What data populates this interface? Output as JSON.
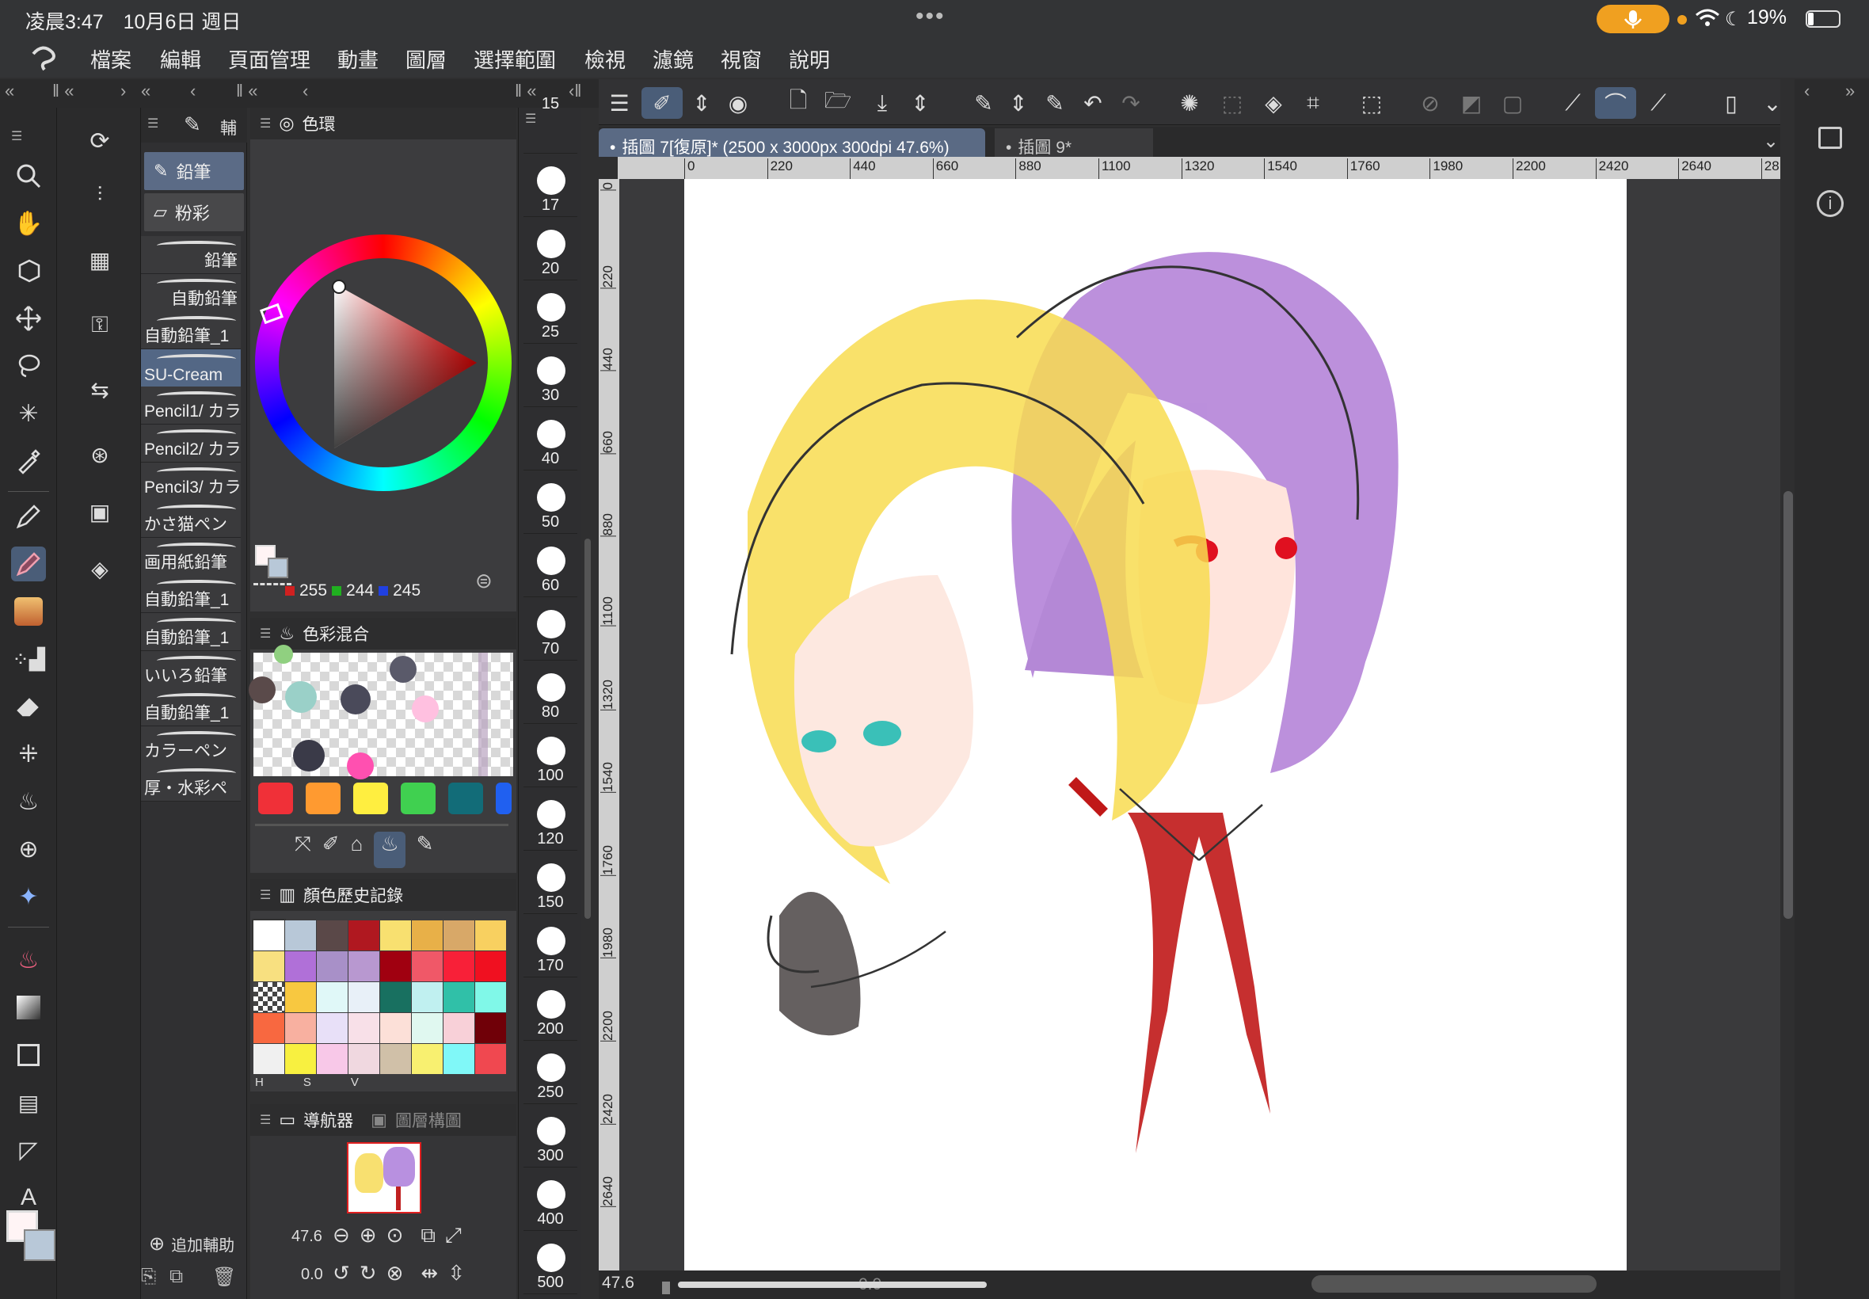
{
  "status": {
    "time": "凌晨3:47　10月6日 週日",
    "dots": "•••",
    "battery": "19%"
  },
  "menu": [
    "檔案",
    "編輯",
    "頁面管理",
    "動畫",
    "圖層",
    "選擇範圍",
    "檢視",
    "濾鏡",
    "視窗",
    "說明"
  ],
  "brush_panel": {
    "header": "輔",
    "tabs": [
      {
        "label": "鉛筆",
        "selected": true
      },
      {
        "label": "粉彩",
        "selected": false
      }
    ],
    "items": [
      {
        "label": "鉛筆",
        "selected": false
      },
      {
        "label": "自動鉛筆",
        "selected": false
      },
      {
        "label": "自動鉛筆_1",
        "selected": false
      },
      {
        "label": "SU-Cream",
        "selected": true
      },
      {
        "label": "Pencil1/ カラ",
        "selected": false
      },
      {
        "label": "Pencil2/ カラ",
        "selected": false
      },
      {
        "label": "Pencil3/ カラ",
        "selected": false
      },
      {
        "label": "かさ猫ペン",
        "selected": false
      },
      {
        "label": "画用紙鉛筆",
        "selected": false
      },
      {
        "label": "自動鉛筆_1",
        "selected": false
      },
      {
        "label": "自動鉛筆_1",
        "selected": false
      },
      {
        "label": "いいろ鉛筆",
        "selected": false
      },
      {
        "label": "自動鉛筆_1",
        "selected": false
      },
      {
        "label": "カラーペン",
        "selected": false
      },
      {
        "label": "厚・水彩ペ",
        "selected": false
      }
    ],
    "add_label": "追加輔助"
  },
  "color_wheel": {
    "title": "色環",
    "r": "255",
    "g": "244",
    "b": "245"
  },
  "color_mix": {
    "title": "色彩混合",
    "swatches": [
      "#f03038",
      "#ff9a30",
      "#ffee40",
      "#40d050",
      "#126c78",
      "#2060f0"
    ]
  },
  "history": {
    "title": "顏色歷史記錄",
    "hsv": [
      "H",
      "S",
      "V"
    ],
    "colors": [
      "#ffffff",
      "#b8c8d8",
      "#5a4848",
      "#b01820",
      "#f8e070",
      "#e8b048",
      "#d8a868",
      "#f8d060",
      "#f8e080",
      "#b070d8",
      "#a890c8",
      "#b898d0",
      "#a00010",
      "#f05868",
      "#f82038",
      "#f01020",
      "checker",
      "#f8c840",
      "#e0f8f8",
      "#e8f0f8",
      "#187060",
      "#c0f0f0",
      "#30c0a8",
      "#80f8e8",
      "#f86840",
      "#f8b0a0",
      "#e8e0f8",
      "#f8e0e8",
      "#fce0d8",
      "#e0f8f0",
      "#f8d0d8",
      "#700008",
      "#f0f0f0",
      "#f8f040",
      "#f8c8e8",
      "#f0d8e0",
      "#d0c0a8",
      "#f8f070",
      "#80f8f8",
      "#f04850"
    ]
  },
  "navigator": {
    "title": "導航器",
    "tab2": "圖層構圖",
    "zoom": "47.6",
    "rotation": "0.0"
  },
  "brush_sizes": [
    "15",
    "17",
    "20",
    "25",
    "30",
    "40",
    "50",
    "60",
    "70",
    "80",
    "100",
    "120",
    "150",
    "170",
    "200",
    "250",
    "300",
    "400",
    "500"
  ],
  "tabs": {
    "active": "插圖 7[復原]* (2500 x 3000px 300dpi 47.6%)",
    "other": "插圖 9*"
  },
  "ruler_h": [
    "0",
    "220",
    "440",
    "660",
    "880",
    "1100",
    "1320",
    "1540",
    "1760",
    "1980",
    "2200",
    "2420",
    "2640",
    "28"
  ],
  "ruler_v": [
    "0",
    "220",
    "440",
    "660",
    "880",
    "1100",
    "1320",
    "1540",
    "1760",
    "1980",
    "2200",
    "2420",
    "2640"
  ],
  "bottom": {
    "zoom": "47.6",
    "rot": "0.0"
  }
}
